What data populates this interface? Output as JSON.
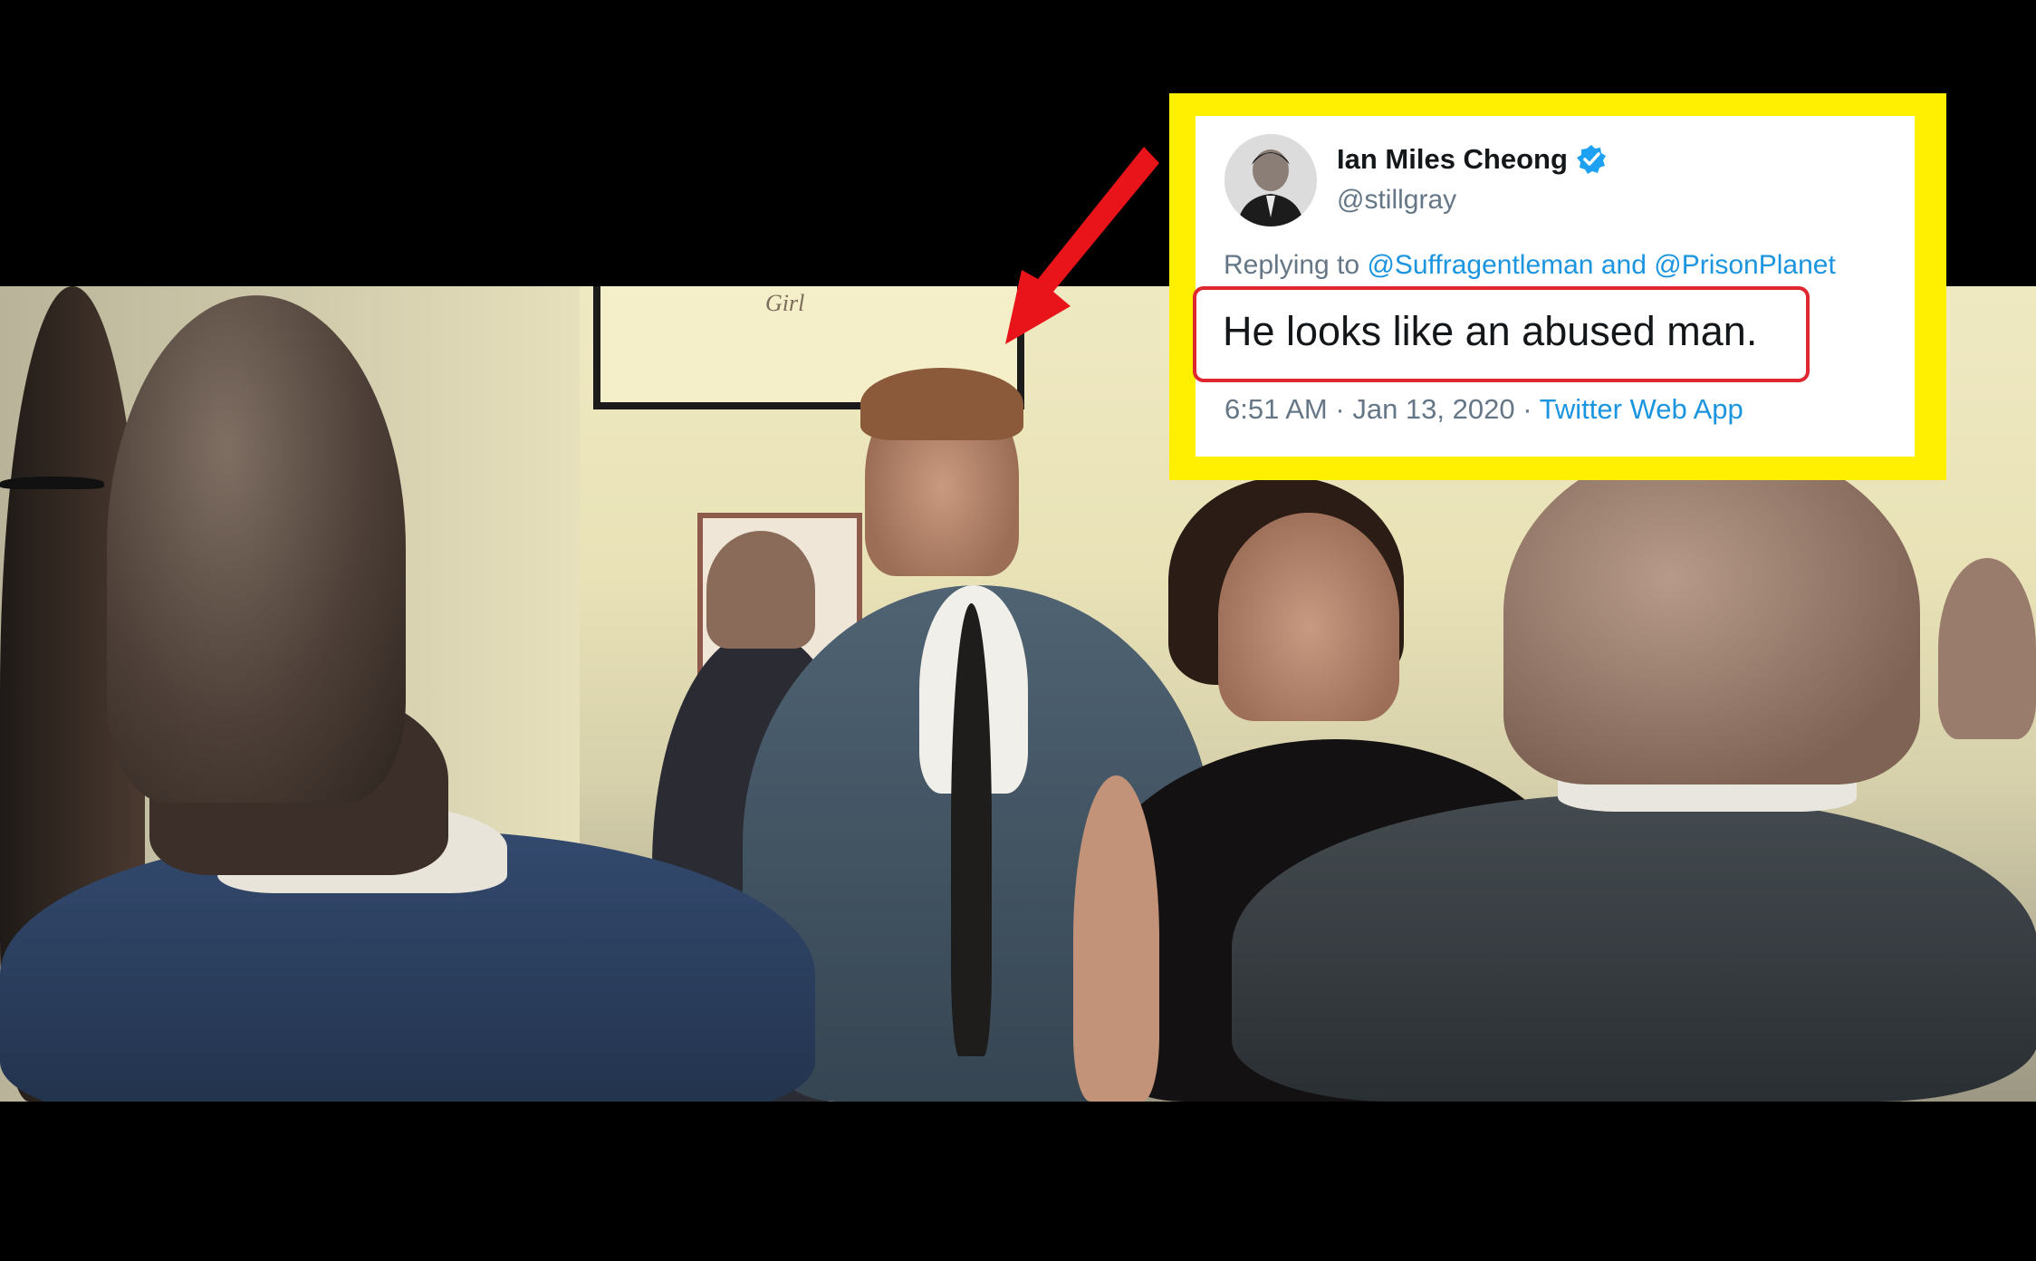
{
  "tweet": {
    "display_name": "Ian Miles Cheong",
    "handle": "@stillgray",
    "reply_prefix": "Replying to",
    "reply_user_1": "@Suffragentleman",
    "reply_joiner": "and",
    "reply_user_2": "@PrisonPlanet",
    "text": "He looks like an abused man.",
    "time": "6:51 AM",
    "date": "Jan 13, 2020",
    "separator": "·",
    "source": "Twitter Web App",
    "verified_icon": "verified-badge-icon"
  },
  "video": {
    "screen_sign": "Girl"
  },
  "colors": {
    "frame_yellow": "#ffef00",
    "arrow_red": "#e8141a",
    "highlight_red": "#e0262e",
    "twitter_blue": "#1b95e0",
    "muted_gray": "#657786"
  }
}
